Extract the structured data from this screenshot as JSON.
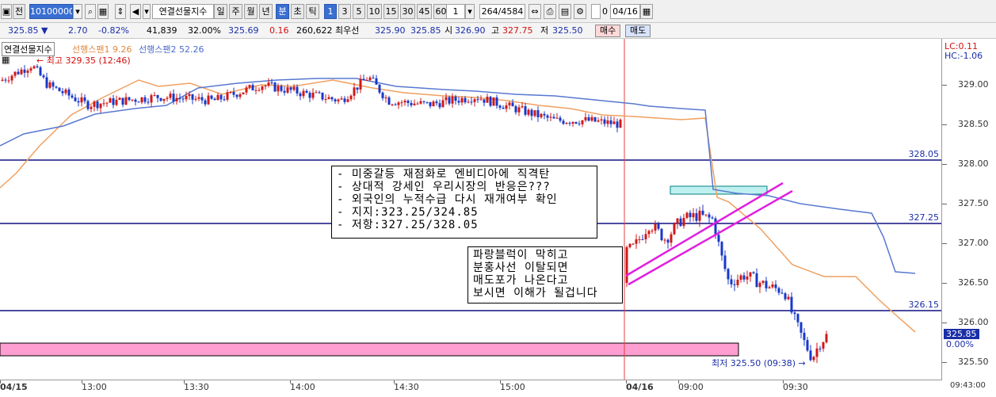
{
  "toolbar": {
    "code_value": "10100000",
    "chart_label": "전",
    "instrument": "연결선물지수",
    "periods": [
      "일",
      "주",
      "월",
      "년",
      "분",
      "초",
      "틱"
    ],
    "intervals": [
      "1",
      "3",
      "5",
      "10",
      "15",
      "30",
      "45",
      "60"
    ],
    "interval_value": "1",
    "count": "264/4584",
    "date": "04/16",
    "checkbox_label": "0"
  },
  "quote": {
    "price": "325.85 ▼",
    "change": "2.70",
    "change_pct": "-0.82%",
    "volume": "41,839",
    "vol_pct": "32.00%",
    "val1": "325.69",
    "val2": "0.16",
    "open_interest": "260,622",
    "best_label": "최우선",
    "best_bid": "325.90",
    "best_ask": "325.85",
    "open_label": "시",
    "open": "326.90",
    "high_label": "고",
    "high": "327.75",
    "low_label": "저",
    "low": "325.50",
    "buy_label": "매수",
    "sell_label": "매도"
  },
  "legend": {
    "title": "연결선물지수",
    "span1": "선행스팬1 9.26",
    "span2": "선행스팬2 52.26",
    "high_marker": "최고 329.35 (12:46)",
    "low_marker": "최저 325.50 (09:38)"
  },
  "right_labels": {
    "lc": "LC:0.11",
    "hc": "HC:-1.06",
    "current": "325.85",
    "current_pct": "0.00%"
  },
  "notes": {
    "main": [
      "- 미중갈등 재점화로 엔비디아에 직격탄",
      "- 상대적 강세인 우리시장의 반응은???",
      "- 외국인의 누적수급 다시 재개여부 확인",
      "- 지지:323.25/324.85",
      "- 저항:327.25/328.05"
    ],
    "side": [
      "파랑블럭이 막히고",
      "분홍사선 이탈되면",
      "매도포가 나온다고",
      "보시면 이해가 될겁니다"
    ]
  },
  "chart_data": {
    "type": "candlestick",
    "y_ticks": [
      "329.00",
      "328.50",
      "328.00",
      "327.50",
      "327.00",
      "326.50",
      "326.00",
      "325.50"
    ],
    "x_ticks": [
      "04/15",
      "13:00",
      "13:30",
      "14:00",
      "14:30",
      "15:00",
      "04/16",
      "09:00",
      "09:30",
      "09:43:00"
    ],
    "ylim": [
      325.28,
      329.58
    ],
    "horizontal_levels": [
      {
        "value": 328.05,
        "label": "328.05"
      },
      {
        "value": 327.25,
        "label": "327.25"
      },
      {
        "value": 326.15,
        "label": "326.15"
      }
    ],
    "high": 329.35,
    "low": 325.5,
    "last": 325.85,
    "colors": {
      "up": "#d01818",
      "down": "#1838c8",
      "span1": "#f0a060",
      "span2": "#5878d0",
      "level": "#101080",
      "pink_line": "#e020e0",
      "pink_zone": "#ff9ed0",
      "cyan_zone": "#bff0f0"
    }
  }
}
